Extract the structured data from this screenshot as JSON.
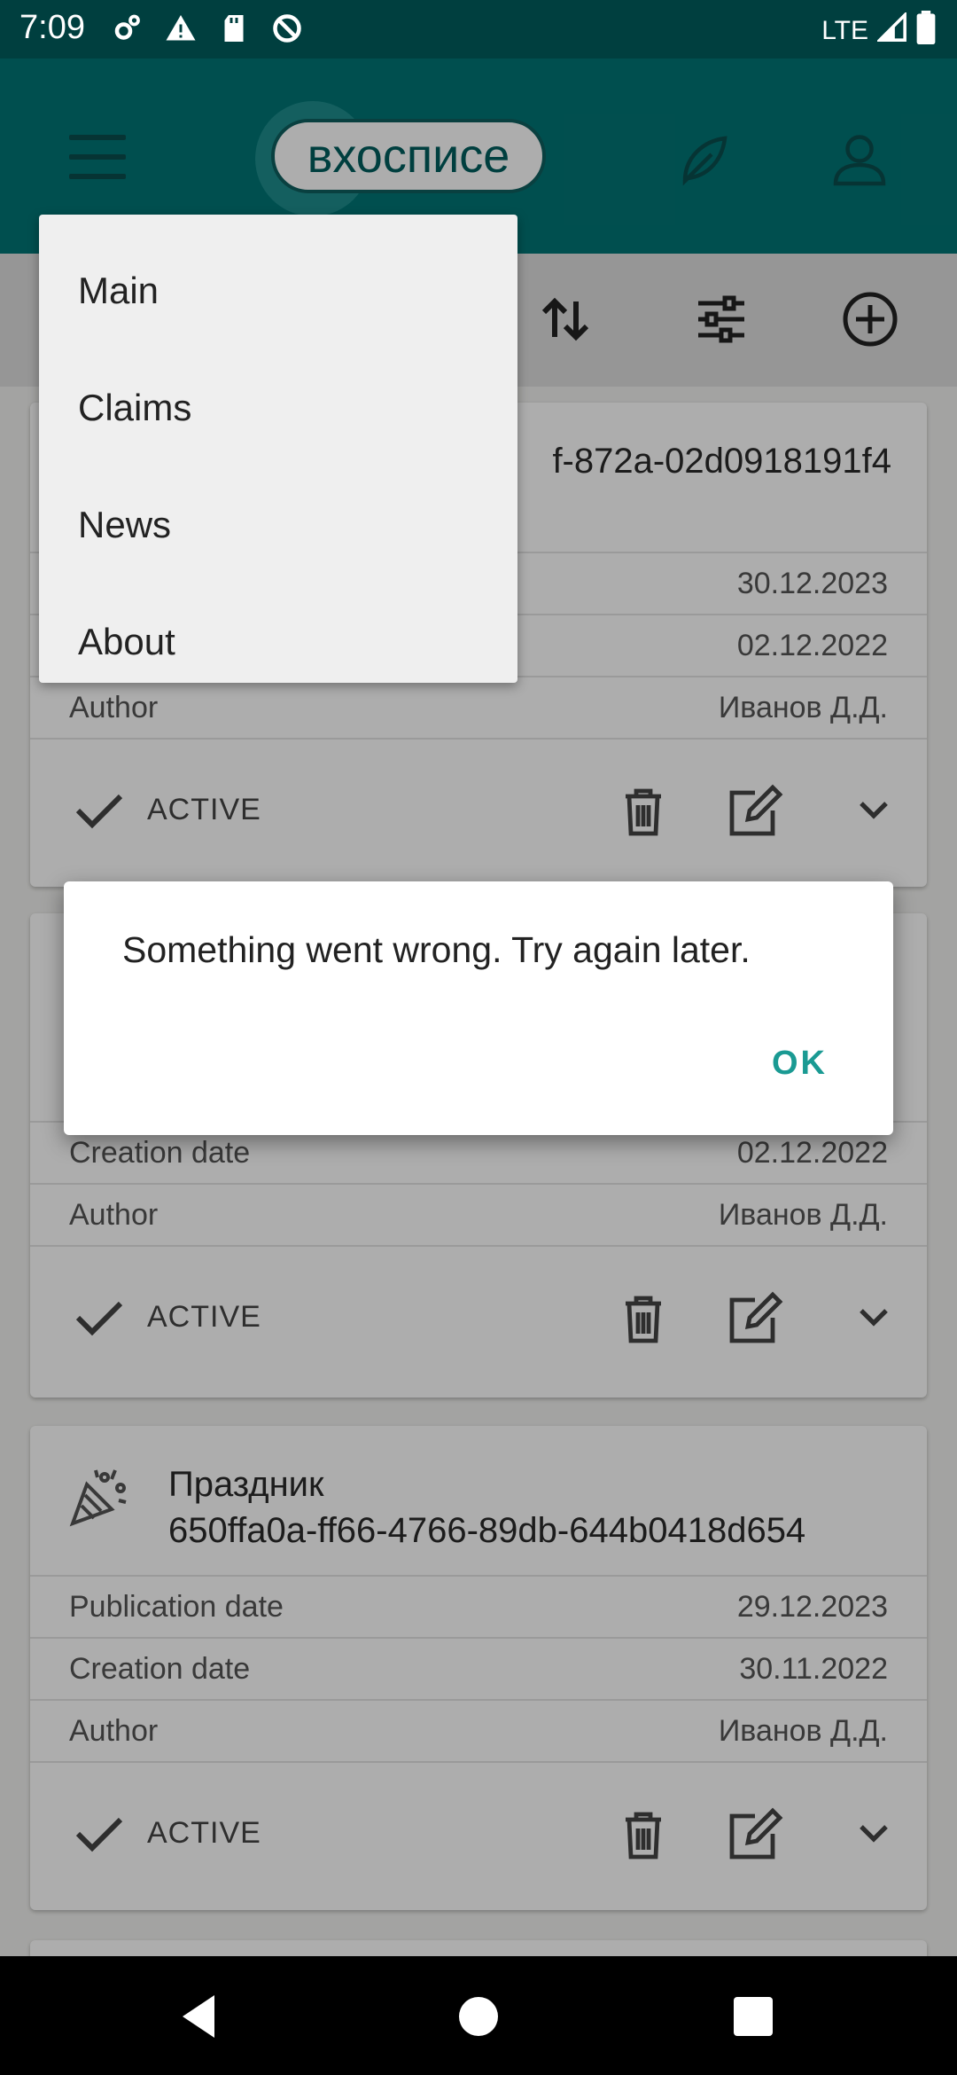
{
  "status_bar": {
    "time": "7:09",
    "network": "LTE",
    "icons": [
      "settings-cog-icon",
      "warning-icon",
      "sd-card-icon",
      "no-sync-icon",
      "signal-icon",
      "battery-icon"
    ]
  },
  "app_bar": {
    "logo_text": "вхосписе",
    "icons": [
      "menu-icon",
      "leaf-icon",
      "profile-icon"
    ]
  },
  "toolbar": {
    "icons": [
      "sort-icon",
      "filter-icon",
      "add-icon"
    ]
  },
  "menu": {
    "items": [
      {
        "label": "Main"
      },
      {
        "label": "Claims"
      },
      {
        "label": "News"
      },
      {
        "label": "About"
      }
    ]
  },
  "cards": [
    {
      "title_line1": "",
      "title_line2": "f-872a-02d0918191f4",
      "rows": [
        {
          "label": "",
          "value": "30.12.2023"
        },
        {
          "label": "",
          "value": "02.12.2022"
        },
        {
          "label": "Author",
          "value": "Иванов Д.Д."
        }
      ],
      "status": "ACTIVE"
    },
    {
      "title_line1": "",
      "title_line2": "",
      "rows": [
        {
          "label": "Creation date",
          "value": "02.12.2022"
        },
        {
          "label": "Author",
          "value": "Иванов Д.Д."
        }
      ],
      "status": "ACTIVE"
    },
    {
      "title_line1": "Праздник",
      "title_line2": "650ffa0a-ff66-4766-89db-644b0418d654",
      "rows": [
        {
          "label": "Publication date",
          "value": "29.12.2023"
        },
        {
          "label": "Creation date",
          "value": "30.11.2022"
        },
        {
          "label": "Author",
          "value": "Иванов Д.Д."
        }
      ],
      "status": "ACTIVE"
    }
  ],
  "dialog": {
    "message": "Something went wrong. Try again later.",
    "ok_label": "OK"
  },
  "colors": {
    "status_bar": "#003f3f",
    "app_bar": "#017575",
    "accent": "#1a9a93",
    "scrim": "rgba(0,0,0,0.32)"
  }
}
